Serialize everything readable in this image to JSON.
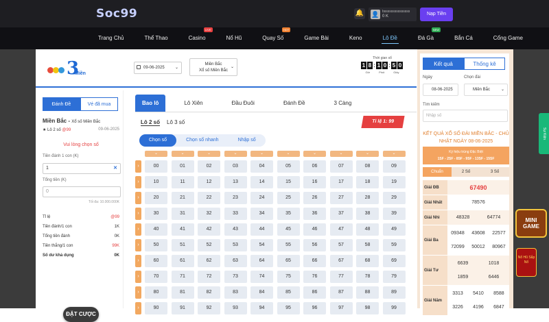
{
  "header": {
    "logo": "Soc99",
    "user_name": "bsssssssssssssss",
    "balance": "0 K",
    "deposit_label": "Nạp Tiền"
  },
  "nav": [
    {
      "label": "Trang Chủ",
      "tag": ""
    },
    {
      "label": "Thể Thao",
      "tag": ""
    },
    {
      "label": "Casino",
      "tag": "LIVE"
    },
    {
      "label": "Nổ Hũ",
      "tag": ""
    },
    {
      "label": "Quay Số",
      "tag": "HOT"
    },
    {
      "label": "Game Bài",
      "tag": ""
    },
    {
      "label": "Keno",
      "tag": ""
    },
    {
      "label": "Lô Đề",
      "tag": ""
    },
    {
      "label": "Đá Gà",
      "tag": "NEW"
    },
    {
      "label": "Bắn Cá",
      "tag": ""
    },
    {
      "label": "Cổng Game",
      "tag": ""
    }
  ],
  "top": {
    "logo_num": "3",
    "logo_mien": "Miền",
    "date": "09-06-2025",
    "region": "Miền Bắc",
    "region_sub": "Xổ số Miền Bắc",
    "countdown_label": "Thời gian xổ",
    "countdown": [
      "1",
      "8",
      "1",
      "0",
      "5",
      "0"
    ],
    "units": [
      "Giờ",
      "Phút",
      "Giây"
    ]
  },
  "left": {
    "tabs": [
      "Đánh Đề",
      "Vé đã mua"
    ],
    "region": "Miền Bắc -",
    "region_sub": "Xổ số Miền Bắc",
    "bet_type": "★ Lô 2 số",
    "bet_rate": "@99",
    "bet_date": "09-06-2025",
    "choose_msg": "Vui lòng chọn số",
    "unit_label": "Tiền đánh 1 con (K)",
    "unit_value": "1",
    "total_label": "Tổng tiền (K)",
    "total_value": "0",
    "max_label": "Tối đa: 10.000.000K",
    "rows": [
      {
        "k": "Tỉ lệ",
        "v": "@99"
      },
      {
        "k": "Tiền đánh/1 con",
        "v": "1K"
      },
      {
        "k": "Tổng tiền đánh",
        "v": "0K"
      },
      {
        "k": "Tiền thắng/1 con",
        "v": "99K"
      },
      {
        "k": "Số dư khả dụng",
        "v": "0K"
      }
    ],
    "bet_button": "ĐẶT CƯỢC"
  },
  "center": {
    "tabs": [
      "Bao lô",
      "Lô Xiên",
      "Đầu Đuôi",
      "Đánh Đề",
      "3 Càng"
    ],
    "subtabs": [
      "Lô 2 số",
      "Lô 3 số"
    ],
    "rate": "Tỉ lệ 1: 99",
    "modes": [
      "Chọn số",
      "Chọn số nhanh",
      "Nhập số"
    ],
    "rows": [
      [
        "00",
        "01",
        "02",
        "03",
        "04",
        "05",
        "06",
        "07",
        "08",
        "09"
      ],
      [
        "10",
        "11",
        "12",
        "13",
        "14",
        "15",
        "16",
        "17",
        "18",
        "19"
      ],
      [
        "20",
        "21",
        "22",
        "23",
        "24",
        "25",
        "26",
        "27",
        "28",
        "29"
      ],
      [
        "30",
        "31",
        "32",
        "33",
        "34",
        "35",
        "36",
        "37",
        "38",
        "39"
      ],
      [
        "40",
        "41",
        "42",
        "43",
        "44",
        "45",
        "46",
        "47",
        "48",
        "49"
      ],
      [
        "50",
        "51",
        "52",
        "53",
        "54",
        "55",
        "56",
        "57",
        "58",
        "59"
      ],
      [
        "60",
        "61",
        "62",
        "63",
        "64",
        "65",
        "66",
        "67",
        "68",
        "69"
      ],
      [
        "70",
        "71",
        "72",
        "73",
        "74",
        "75",
        "76",
        "77",
        "78",
        "79"
      ],
      [
        "80",
        "81",
        "82",
        "83",
        "84",
        "85",
        "86",
        "87",
        "88",
        "89"
      ],
      [
        "90",
        "91",
        "92",
        "93",
        "94",
        "95",
        "96",
        "97",
        "98",
        "99"
      ]
    ]
  },
  "right": {
    "tabs": [
      "Kết quả",
      "Thống kê"
    ],
    "date_label": "Ngày",
    "date": "08-06-2025",
    "region_label": "Chọn đài",
    "region": "Miền Bắc",
    "search_label": "Tìm kiếm",
    "search_placeholder": "Nhập số",
    "result_title": "KẾT QUẢ XỔ SỐ ĐÀI MIỀN BẮC - CHỦ NHẬT NGÀY 08-06-2025",
    "special_label": "Ký hiệu trúng Đặc Biệt",
    "special_codes": "1SF - 2SF - 8SF - 9SF - 13SF - 15SF",
    "ktabs": [
      "Chuẩn",
      "2 Số",
      "3 Số"
    ],
    "prizes": [
      {
        "name": "Giải ĐB",
        "values": [
          "67490"
        ]
      },
      {
        "name": "Giải Nhất",
        "values": [
          "78576"
        ]
      },
      {
        "name": "Giải Nhì",
        "values": [
          "48328",
          "64774"
        ]
      },
      {
        "name": "Giải Ba",
        "values": [
          "09348",
          "43608",
          "22577",
          "72099",
          "50012",
          "80967"
        ]
      },
      {
        "name": "Giải Tư",
        "values": [
          "6639",
          "1018",
          "1859",
          "6446"
        ]
      },
      {
        "name": "Giải Năm",
        "values": [
          "3313",
          "5410",
          "8588",
          "3226",
          "4196",
          "6847"
        ]
      }
    ]
  },
  "widgets": {
    "side_tab": "Sự Kiện",
    "minigame": "MINI GAME",
    "nohu": "Nổ Hũ Sắp Nổ"
  }
}
